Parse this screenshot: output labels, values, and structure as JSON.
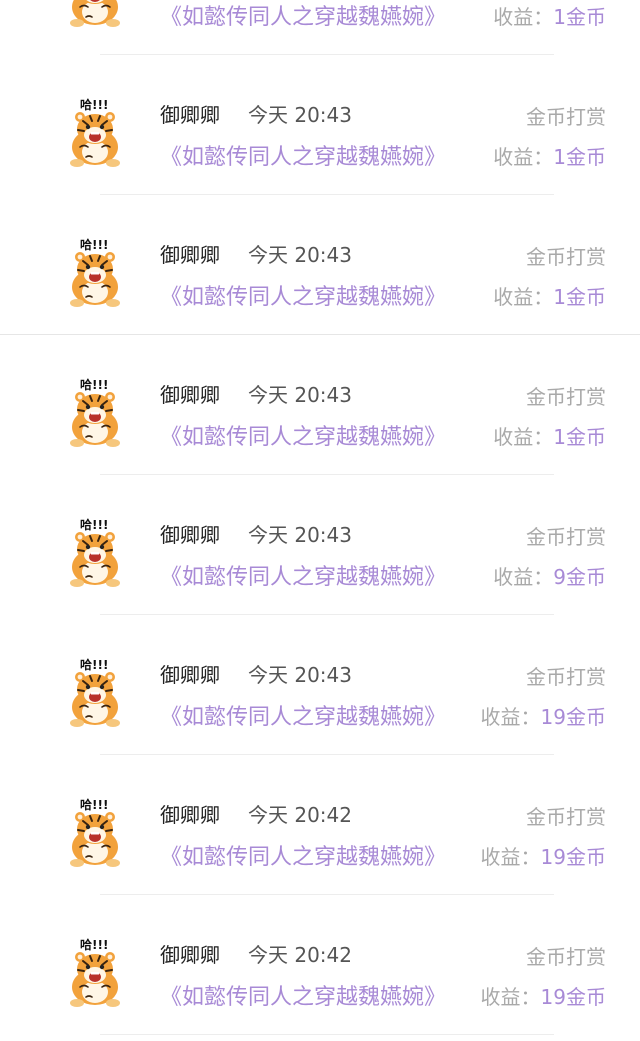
{
  "colors": {
    "book_title": "#a88ad6",
    "earnings_value": "#a88ad6",
    "muted_text": "#a9a9a9",
    "username": "#222222"
  },
  "records": [
    {
      "username": "",
      "time": "",
      "type": "",
      "book_title": "《如懿传同人之穿越魏嬿婉》",
      "earnings_label": "收益：",
      "earnings_value": "1金币",
      "avatar_icon": "tiger-sticker-icon",
      "avatar_caption": ""
    },
    {
      "username": "御卿卿",
      "time": "今天 20:43",
      "type": "金币打赏",
      "book_title": "《如懿传同人之穿越魏嬿婉》",
      "earnings_label": "收益：",
      "earnings_value": "1金币",
      "avatar_icon": "tiger-sticker-icon",
      "avatar_caption": "哈!!!"
    },
    {
      "username": "御卿卿",
      "time": "今天 20:43",
      "type": "金币打赏",
      "book_title": "《如懿传同人之穿越魏嬿婉》",
      "earnings_label": "收益：",
      "earnings_value": "1金币",
      "avatar_icon": "tiger-sticker-icon",
      "avatar_caption": "哈!!!"
    },
    {
      "username": "御卿卿",
      "time": "今天 20:43",
      "type": "金币打赏",
      "book_title": "《如懿传同人之穿越魏嬿婉》",
      "earnings_label": "收益：",
      "earnings_value": "1金币",
      "avatar_icon": "tiger-sticker-icon",
      "avatar_caption": "哈!!!"
    },
    {
      "username": "御卿卿",
      "time": "今天 20:43",
      "type": "金币打赏",
      "book_title": "《如懿传同人之穿越魏嬿婉》",
      "earnings_label": "收益：",
      "earnings_value": "9金币",
      "avatar_icon": "tiger-sticker-icon",
      "avatar_caption": "哈!!!"
    },
    {
      "username": "御卿卿",
      "time": "今天 20:43",
      "type": "金币打赏",
      "book_title": "《如懿传同人之穿越魏嬿婉》",
      "earnings_label": "收益：",
      "earnings_value": "19金币",
      "avatar_icon": "tiger-sticker-icon",
      "avatar_caption": "哈!!!"
    },
    {
      "username": "御卿卿",
      "time": "今天 20:42",
      "type": "金币打赏",
      "book_title": "《如懿传同人之穿越魏嬿婉》",
      "earnings_label": "收益：",
      "earnings_value": "19金币",
      "avatar_icon": "tiger-sticker-icon",
      "avatar_caption": "哈!!!"
    },
    {
      "username": "御卿卿",
      "time": "今天 20:42",
      "type": "金币打赏",
      "book_title": "《如懿传同人之穿越魏嬿婉》",
      "earnings_label": "收益：",
      "earnings_value": "19金币",
      "avatar_icon": "tiger-sticker-icon",
      "avatar_caption": "哈!!!"
    }
  ]
}
